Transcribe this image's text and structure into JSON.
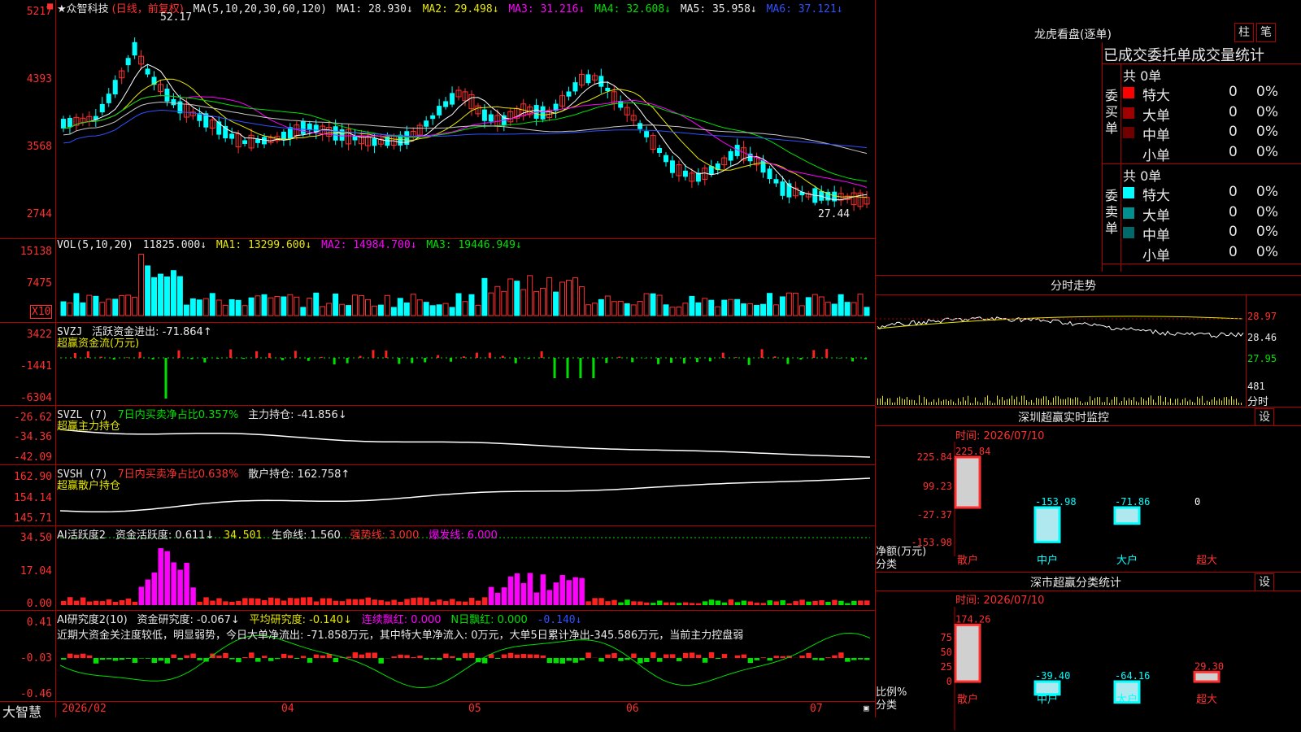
{
  "header": {
    "stock_name": "★众智科技",
    "period": "(日线，前复权)",
    "ma_label": "MA(5,10,20,30,60,120)",
    "ma1": "MA1: 28.930↓",
    "ma2": "MA2: 29.498↓",
    "ma3": "MA3: 31.216↓",
    "ma4": "MA4: 32.608↓",
    "ma5": "MA5: 35.958↓",
    "ma6": "MA6: 37.121↓",
    "high_mark": "52.17",
    "low_mark": "27.44"
  },
  "price_axis": [
    "5217",
    "4393",
    "3568",
    "2744"
  ],
  "vol": {
    "label": "VOL(5,10,20)",
    "value": "11825.000↓",
    "ma1": "MA1: 13299.600↓",
    "ma2": "MA2: 14984.700↓",
    "ma3": "MA3: 19446.949↓",
    "axis": [
      "15138",
      "7475"
    ],
    "unit": "X10"
  },
  "svzj": {
    "label": "SVZJ",
    "text": "活跃资金进出: -71.864↑",
    "sub": "超赢资金流(万元)",
    "axis": [
      "3422",
      "-1441",
      "-6304"
    ]
  },
  "svzl": {
    "label": "SVZL (7)",
    "ratio": "7日内买卖净占比0.357%",
    "hold": "主力持仓: -41.856↓",
    "sub": "超赢主力持仓",
    "axis": [
      "-26.62",
      "-34.36",
      "-42.09"
    ]
  },
  "svsh": {
    "label": "SVSH (7)",
    "ratio": "7日内买卖净占比0.638%",
    "hold": "散户持仓: 162.758↑",
    "sub": "超赢散户持仓",
    "axis": [
      "162.90",
      "154.14",
      "145.71"
    ]
  },
  "ai_active": {
    "label": "AI活跃度2",
    "v1": "资金活跃度: 0.611↓",
    "v2": "34.501",
    "v3": "生命线: 1.560",
    "v4": "强势线: 3.000",
    "v5": "爆发线: 6.000",
    "axis": [
      "34.50",
      "17.04",
      "0.00"
    ]
  },
  "ai_research": {
    "label": "AI研究度2(10)",
    "v1": "资金研究度: -0.067↓",
    "v2": "平均研究度: -0.140↓",
    "v3": "连续飘红: 0.000",
    "v4": "N日飘红: 0.000",
    "v5": "-0.140↓",
    "comment": "近期大资金关注度较低，明显弱势，今日大单净流出: -71.858万元，其中特大单净流入: 0万元，大单5日累计净出-345.586万元，当前主力控盘弱",
    "axis": [
      "0.41",
      "-0.03",
      "-0.46"
    ]
  },
  "bottom": {
    "brand": "大智慧",
    "dates": [
      "2026/02",
      "04",
      "05",
      "06",
      "07"
    ]
  },
  "dragon": {
    "title": "龙虎看盘(逐单)",
    "btn1": "柱",
    "btn2": "笔",
    "header": "已成交委托单成交量统计",
    "buy_label": "委买单",
    "sell_label": "委卖单",
    "buy_total": "共 0单",
    "sell_total": "共 0单",
    "buy_rows": [
      {
        "name": "特大",
        "val": "0",
        "pct": "0%",
        "color": "#ff0000"
      },
      {
        "name": "大单",
        "val": "0",
        "pct": "0%",
        "color": "#a00000"
      },
      {
        "name": "中单",
        "val": "0",
        "pct": "0%",
        "color": "#700000"
      },
      {
        "name": "小单",
        "val": "0",
        "pct": "0%",
        "color": ""
      }
    ],
    "sell_rows": [
      {
        "name": "特大",
        "val": "0",
        "pct": "0%",
        "color": "#00ffff"
      },
      {
        "name": "大单",
        "val": "0",
        "pct": "0%",
        "color": "#009090"
      },
      {
        "name": "中单",
        "val": "0",
        "pct": "0%",
        "color": "#006a6a"
      },
      {
        "name": "小单",
        "val": "0",
        "pct": "0%",
        "color": ""
      }
    ]
  },
  "intraday": {
    "title": "分时走势",
    "axis": [
      "28.97",
      "28.46",
      "27.95"
    ],
    "vol_value": "481",
    "vol_label": "分时"
  },
  "monitor": {
    "title": "深圳超赢实时监控",
    "set_btn": "设",
    "time": "时间: 2026/07/10",
    "axis": [
      "225.84",
      "99.23",
      "-27.37",
      "-153.98"
    ],
    "ylabel": "净额(万元)",
    "xlabel": "分类",
    "bars": [
      {
        "name": "散户",
        "value": 225.84,
        "label": "225.84"
      },
      {
        "name": "中户",
        "value": -153.98,
        "label": "-153.98"
      },
      {
        "name": "大户",
        "value": -71.86,
        "label": "-71.86"
      },
      {
        "name": "超大",
        "value": 0,
        "label": "0"
      }
    ]
  },
  "classify": {
    "title": "深市超赢分类统计",
    "set_btn": "设",
    "time": "时间: 2026/07/10",
    "axis": [
      "75",
      "50",
      "25",
      "0"
    ],
    "ylabel": "比例%",
    "xlabel": "分类",
    "bars": [
      {
        "name": "散户",
        "value": 174.26,
        "label": "174.26"
      },
      {
        "name": "中户",
        "value": -39.4,
        "label": "-39.40"
      },
      {
        "name": "大户",
        "value": -64.16,
        "label": "-64.16"
      },
      {
        "name": "超大",
        "value": 29.3,
        "label": "29.30"
      }
    ]
  }
}
